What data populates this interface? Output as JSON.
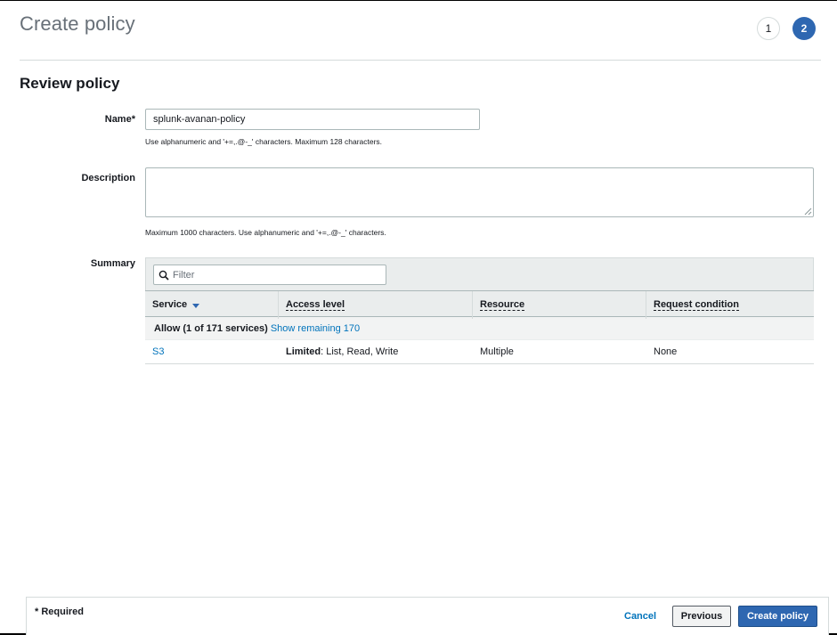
{
  "page": {
    "title": "Create policy",
    "steps": [
      {
        "label": "1",
        "state": "inactive"
      },
      {
        "label": "2",
        "state": "active"
      }
    ]
  },
  "review": {
    "section_title": "Review policy",
    "name_label": "Name*",
    "name_value": "splunk-avanan-policy",
    "name_hint": "Use alphanumeric and '+=,.@-_' characters. Maximum 128 characters.",
    "description_label": "Description",
    "description_value": "",
    "description_hint": "Maximum 1000 characters. Use alphanumeric and '+=,.@-_' characters.",
    "summary_label": "Summary"
  },
  "summary": {
    "filter_placeholder": "Filter",
    "columns": [
      "Service",
      "Access level",
      "Resource",
      "Request condition"
    ],
    "group_label": "Allow (1 of 171 services)",
    "group_link": "Show remaining 170",
    "rows": [
      {
        "service": "S3",
        "access_level_bold": "Limited",
        "access_level_rest": ": List, Read, Write",
        "resource": "Multiple",
        "request_condition": "None"
      }
    ]
  },
  "footer": {
    "required_note": "* Required",
    "cancel_label": "Cancel",
    "previous_label": "Previous",
    "create_label": "Create policy"
  },
  "colors": {
    "primary": "#2e67b1",
    "link": "#0073bb",
    "title_gray": "#687078"
  },
  "icons": {
    "filter": "search-icon",
    "sort": "caret-down-icon",
    "resize": "resize-grip-icon"
  }
}
